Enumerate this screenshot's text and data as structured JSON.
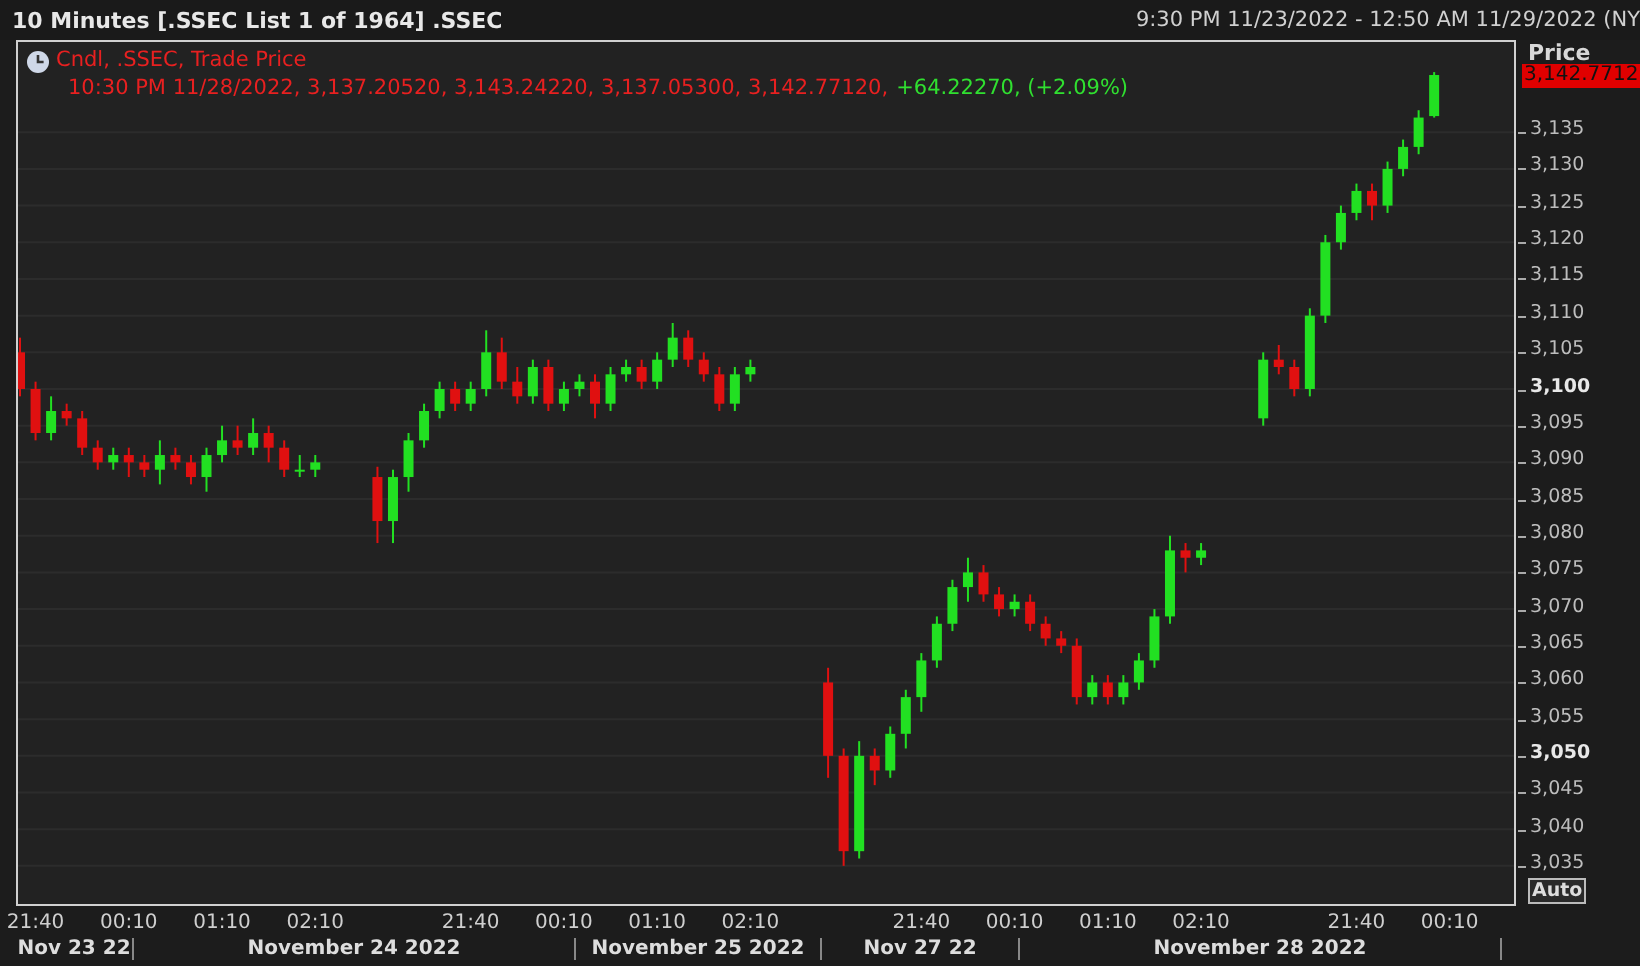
{
  "window": {
    "title": "10 Minutes [.SSEC List 1 of 1964] .SSEC",
    "range": "9:30 PM 11/23/2022 - 12:50 AM 11/29/2022 (NY"
  },
  "legend": {
    "title": "Cndl, .SSEC, Trade Price",
    "values": "10:30 PM 11/28/2022, 3,137.20520, 3,143.24220, 3,137.05300, 3,142.77120,",
    "change": "+64.22270, (+2.09%)"
  },
  "price_axis": {
    "title": "Price",
    "last_price": "3,142.7712",
    "auto_button": "Auto"
  },
  "date_bands": [
    "Nov 23 22",
    "November 24 2022",
    "November 25 2022",
    "Nov 27 22",
    "November 28 2022"
  ],
  "chart_data": {
    "type": "candlestick",
    "ylim": [
      3029.8,
      3147.3
    ],
    "grid": true,
    "yticks": [
      {
        "value": 3035,
        "label": "3,035"
      },
      {
        "value": 3040,
        "label": "3,040"
      },
      {
        "value": 3045,
        "label": "3,045"
      },
      {
        "value": 3050,
        "label": "3,050"
      },
      {
        "value": 3055,
        "label": "3,055"
      },
      {
        "value": 3060,
        "label": "3,060"
      },
      {
        "value": 3065,
        "label": "3,065"
      },
      {
        "value": 3070,
        "label": "3,070"
      },
      {
        "value": 3075,
        "label": "3,075"
      },
      {
        "value": 3080,
        "label": "3,080"
      },
      {
        "value": 3085,
        "label": "3,085"
      },
      {
        "value": 3090,
        "label": "3,090"
      },
      {
        "value": 3095,
        "label": "3,095"
      },
      {
        "value": 3100,
        "label": "3,100"
      },
      {
        "value": 3105,
        "label": "3,105"
      },
      {
        "value": 3110,
        "label": "3,110"
      },
      {
        "value": 3115,
        "label": "3,115"
      },
      {
        "value": 3120,
        "label": "3,120"
      },
      {
        "value": 3125,
        "label": "3,125"
      },
      {
        "value": 3130,
        "label": "3,130"
      },
      {
        "value": 3135,
        "label": "3,135"
      }
    ],
    "categories": [
      null,
      "21:40",
      null,
      null,
      null,
      null,
      null,
      "00:10",
      null,
      null,
      null,
      null,
      null,
      "01:10",
      null,
      null,
      null,
      null,
      null,
      "02:10",
      null,
      null,
      null,
      null,
      null,
      null,
      null,
      null,
      null,
      "21:40",
      null,
      null,
      null,
      null,
      null,
      "00:10",
      null,
      null,
      null,
      null,
      null,
      "01:10",
      null,
      null,
      null,
      null,
      null,
      "02:10",
      null,
      null,
      null,
      null,
      null,
      null,
      null,
      null,
      null,
      null,
      "21:40",
      null,
      null,
      null,
      null,
      null,
      "00:10",
      null,
      null,
      null,
      null,
      null,
      "01:10",
      null,
      null,
      null,
      null,
      null,
      "02:10",
      null,
      null,
      null,
      null,
      null,
      null,
      null,
      null,
      null,
      "21:40",
      null,
      null,
      null,
      null,
      null,
      "00:10"
    ],
    "ohlc": [
      [
        3105,
        3107,
        3099,
        3100
      ],
      [
        3100,
        3101,
        3093,
        3094
      ],
      [
        3094,
        3099,
        3093,
        3097
      ],
      [
        3097,
        3098,
        3095,
        3096
      ],
      [
        3096,
        3097,
        3091,
        3092
      ],
      [
        3092,
        3093,
        3089,
        3090
      ],
      [
        3090,
        3092,
        3089,
        3091
      ],
      [
        3091,
        3092,
        3088,
        3090
      ],
      [
        3090,
        3091,
        3088,
        3089
      ],
      [
        3089,
        3093,
        3087,
        3091
      ],
      [
        3091,
        3092,
        3089,
        3090
      ],
      [
        3090,
        3091,
        3087,
        3088
      ],
      [
        3088,
        3092,
        3086,
        3091
      ],
      [
        3091,
        3095,
        3090,
        3093
      ],
      [
        3093,
        3095,
        3091,
        3092
      ],
      [
        3092,
        3096,
        3091,
        3094
      ],
      [
        3094,
        3095,
        3090,
        3092
      ],
      [
        3092,
        3093,
        3088,
        3089
      ],
      [
        3089,
        3091,
        3088,
        3089
      ],
      [
        3089,
        3091,
        3088,
        3090
      ],
      null,
      null,
      null,
      [
        3088,
        3089.4,
        3079,
        3082
      ],
      [
        3082,
        3089,
        3079,
        3088
      ],
      [
        3088,
        3094,
        3086,
        3093
      ],
      [
        3093,
        3098,
        3092,
        3097
      ],
      [
        3097,
        3101,
        3096,
        3100
      ],
      [
        3100,
        3101,
        3097,
        3098
      ],
      [
        3098,
        3101,
        3097,
        3100
      ],
      [
        3100,
        3108,
        3099,
        3105
      ],
      [
        3105,
        3107,
        3100,
        3101
      ],
      [
        3101,
        3103,
        3098,
        3099
      ],
      [
        3099,
        3104,
        3098,
        3103
      ],
      [
        3103,
        3104,
        3097,
        3098
      ],
      [
        3098,
        3101,
        3097,
        3100
      ],
      [
        3100,
        3102,
        3099,
        3101
      ],
      [
        3101,
        3102,
        3096,
        3098
      ],
      [
        3098,
        3103,
        3097,
        3102
      ],
      [
        3102,
        3104,
        3101,
        3103
      ],
      [
        3103,
        3104,
        3100,
        3101
      ],
      [
        3101,
        3105,
        3100,
        3104
      ],
      [
        3104,
        3109,
        3103,
        3107
      ],
      [
        3107,
        3108,
        3103,
        3104
      ],
      [
        3104,
        3105,
        3101,
        3102
      ],
      [
        3102,
        3103,
        3097,
        3098
      ],
      [
        3098,
        3103,
        3097,
        3102
      ],
      [
        3102,
        3104,
        3101,
        3103
      ],
      null,
      null,
      null,
      null,
      [
        3060,
        3062,
        3047,
        3050
      ],
      [
        3050,
        3051,
        3035,
        3037
      ],
      [
        3037,
        3052,
        3036,
        3050
      ],
      [
        3050,
        3051,
        3046,
        3048
      ],
      [
        3048,
        3054,
        3047,
        3053
      ],
      [
        3053,
        3059,
        3051,
        3058
      ],
      [
        3058,
        3064,
        3056,
        3063
      ],
      [
        3063,
        3069,
        3062,
        3068
      ],
      [
        3068,
        3074,
        3067,
        3073
      ],
      [
        3073,
        3077,
        3071,
        3075
      ],
      [
        3075,
        3076,
        3071,
        3072
      ],
      [
        3072,
        3073,
        3069,
        3070
      ],
      [
        3070,
        3072,
        3069,
        3071
      ],
      [
        3071,
        3072,
        3067,
        3068
      ],
      [
        3068,
        3069,
        3065,
        3066
      ],
      [
        3066,
        3067,
        3064,
        3065
      ],
      [
        3065,
        3066,
        3057,
        3058
      ],
      [
        3058,
        3061,
        3057,
        3060
      ],
      [
        3060,
        3061,
        3057,
        3058
      ],
      [
        3058,
        3061,
        3057,
        3060
      ],
      [
        3060,
        3064,
        3059,
        3063
      ],
      [
        3063,
        3070,
        3062,
        3069
      ],
      [
        3069,
        3080,
        3068,
        3078
      ],
      [
        3078,
        3079,
        3075,
        3077
      ],
      [
        3077,
        3079,
        3076,
        3078
      ],
      null,
      null,
      null,
      [
        3096,
        3105,
        3095,
        3104
      ],
      [
        3104,
        3106,
        3102,
        3103
      ],
      [
        3103,
        3104,
        3099,
        3100
      ],
      [
        3100,
        3111,
        3099,
        3110
      ],
      [
        3110,
        3121,
        3109,
        3120
      ],
      [
        3120,
        3125,
        3119,
        3124
      ],
      [
        3124,
        3128,
        3123,
        3127
      ],
      [
        3127,
        3128,
        3123,
        3125
      ],
      [
        3125,
        3131,
        3124,
        3130
      ],
      [
        3130,
        3134,
        3129,
        3133
      ],
      [
        3133,
        3138,
        3132,
        3137
      ],
      [
        3137.2,
        3143.2,
        3137,
        3142.8
      ],
      null
    ]
  }
}
